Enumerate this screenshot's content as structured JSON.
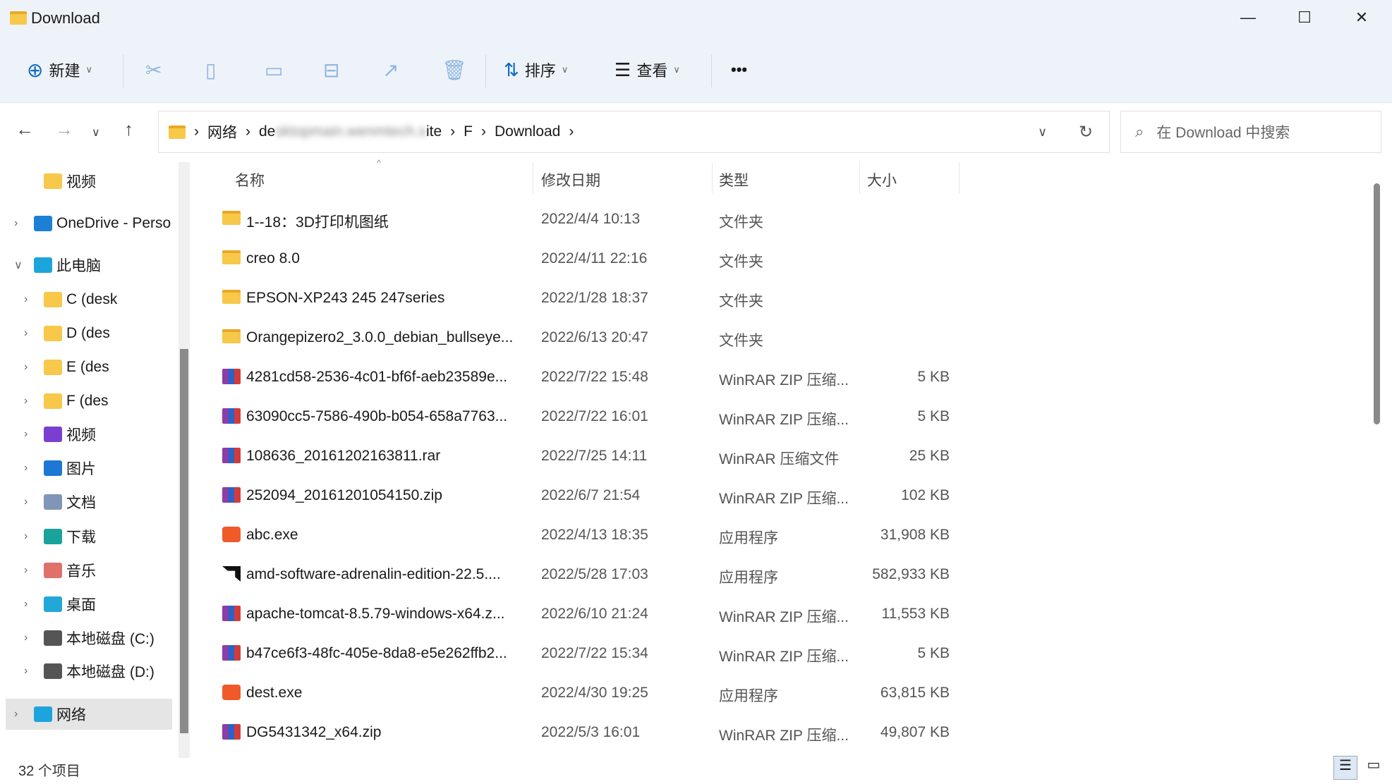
{
  "window": {
    "title": "Download",
    "minimize": "—",
    "maximize": "☐",
    "close": "✕"
  },
  "toolbar": {
    "new_label": "新建",
    "sort_label": "排序",
    "view_label": "查看",
    "more": "•••"
  },
  "address": {
    "crumbs": [
      "网络",
      "de",
      "ite",
      "F",
      "Download"
    ],
    "blurred": "sktopmain.wenmtech.s"
  },
  "search": {
    "placeholder": "在 Download 中搜索"
  },
  "sidebar": {
    "items": [
      {
        "label": "视频",
        "icon": "folder-icon",
        "color": "#f8c84a"
      },
      {
        "label": "OneDrive - Perso",
        "icon": "onedrive-icon",
        "color": "#1e7fd6"
      },
      {
        "label": "此电脑",
        "icon": "computer-icon",
        "color": "#1ea4dc"
      },
      {
        "label": "C (desk",
        "icon": "drive-folder-icon",
        "color": "#f8c84a"
      },
      {
        "label": "D (des",
        "icon": "drive-folder-icon",
        "color": "#f8c84a"
      },
      {
        "label": "E (des",
        "icon": "drive-folder-icon",
        "color": "#f8c84a"
      },
      {
        "label": "F (des",
        "icon": "drive-folder-icon",
        "color": "#f8c84a"
      },
      {
        "label": "视频",
        "icon": "video-icon",
        "color": "#7a3fd1"
      },
      {
        "label": "图片",
        "icon": "picture-icon",
        "color": "#1c78d4"
      },
      {
        "label": "文档",
        "icon": "document-icon",
        "color": "#7f96b8"
      },
      {
        "label": "下载",
        "icon": "download-icon",
        "color": "#19a39b"
      },
      {
        "label": "音乐",
        "icon": "music-icon",
        "color": "#e0706a"
      },
      {
        "label": "桌面",
        "icon": "desktop-icon",
        "color": "#22a8d8"
      },
      {
        "label": "本地磁盘 (C:)",
        "icon": "local-disk-icon",
        "color": "#555555"
      },
      {
        "label": "本地磁盘 (D:)",
        "icon": "local-disk-icon",
        "color": "#555555"
      },
      {
        "label": "网络",
        "icon": "network-icon",
        "color": "#1ea4dc"
      }
    ]
  },
  "columns": {
    "name": "名称",
    "date": "修改日期",
    "type": "类型",
    "size": "大小"
  },
  "files": [
    {
      "name": "1--18：3D打印机图纸",
      "date": "2022/4/4 10:13",
      "type": "文件夹",
      "size": "",
      "icon": "folder"
    },
    {
      "name": "creo 8.0",
      "date": "2022/4/11 22:16",
      "type": "文件夹",
      "size": "",
      "icon": "folder"
    },
    {
      "name": "EPSON-XP243 245 247series",
      "date": "2022/1/28 18:37",
      "type": "文件夹",
      "size": "",
      "icon": "folder"
    },
    {
      "name": "Orangepizero2_3.0.0_debian_bullseye...",
      "date": "2022/6/13 20:47",
      "type": "文件夹",
      "size": "",
      "icon": "folder"
    },
    {
      "name": "4281cd58-2536-4c01-bf6f-aeb23589e...",
      "date": "2022/7/22 15:48",
      "type": "WinRAR ZIP 压缩...",
      "size": "5 KB",
      "icon": "rar"
    },
    {
      "name": "63090cc5-7586-490b-b054-658a7763...",
      "date": "2022/7/22 16:01",
      "type": "WinRAR ZIP 压缩...",
      "size": "5 KB",
      "icon": "rar"
    },
    {
      "name": "108636_20161202163811.rar",
      "date": "2022/7/25 14:11",
      "type": "WinRAR 压缩文件",
      "size": "25 KB",
      "icon": "rar"
    },
    {
      "name": "252094_20161201054150.zip",
      "date": "2022/6/7 21:54",
      "type": "WinRAR ZIP 压缩...",
      "size": "102 KB",
      "icon": "rar"
    },
    {
      "name": "abc.exe",
      "date": "2022/4/13 18:35",
      "type": "应用程序",
      "size": "31,908 KB",
      "icon": "exe"
    },
    {
      "name": "amd-software-adrenalin-edition-22.5....",
      "date": "2022/5/28 17:03",
      "type": "应用程序",
      "size": "582,933 KB",
      "icon": "amd"
    },
    {
      "name": "apache-tomcat-8.5.79-windows-x64.z...",
      "date": "2022/6/10 21:24",
      "type": "WinRAR ZIP 压缩...",
      "size": "11,553 KB",
      "icon": "rar"
    },
    {
      "name": "b47ce6f3-48fc-405e-8da8-e5e262ffb2...",
      "date": "2022/7/22 15:34",
      "type": "WinRAR ZIP 压缩...",
      "size": "5 KB",
      "icon": "rar"
    },
    {
      "name": "dest.exe",
      "date": "2022/4/30 19:25",
      "type": "应用程序",
      "size": "63,815 KB",
      "icon": "exe"
    },
    {
      "name": "DG5431342_x64.zip",
      "date": "2022/5/3 16:01",
      "type": "WinRAR ZIP 压缩...",
      "size": "49,807 KB",
      "icon": "rar"
    }
  ],
  "status": {
    "count": "32 个项目"
  }
}
